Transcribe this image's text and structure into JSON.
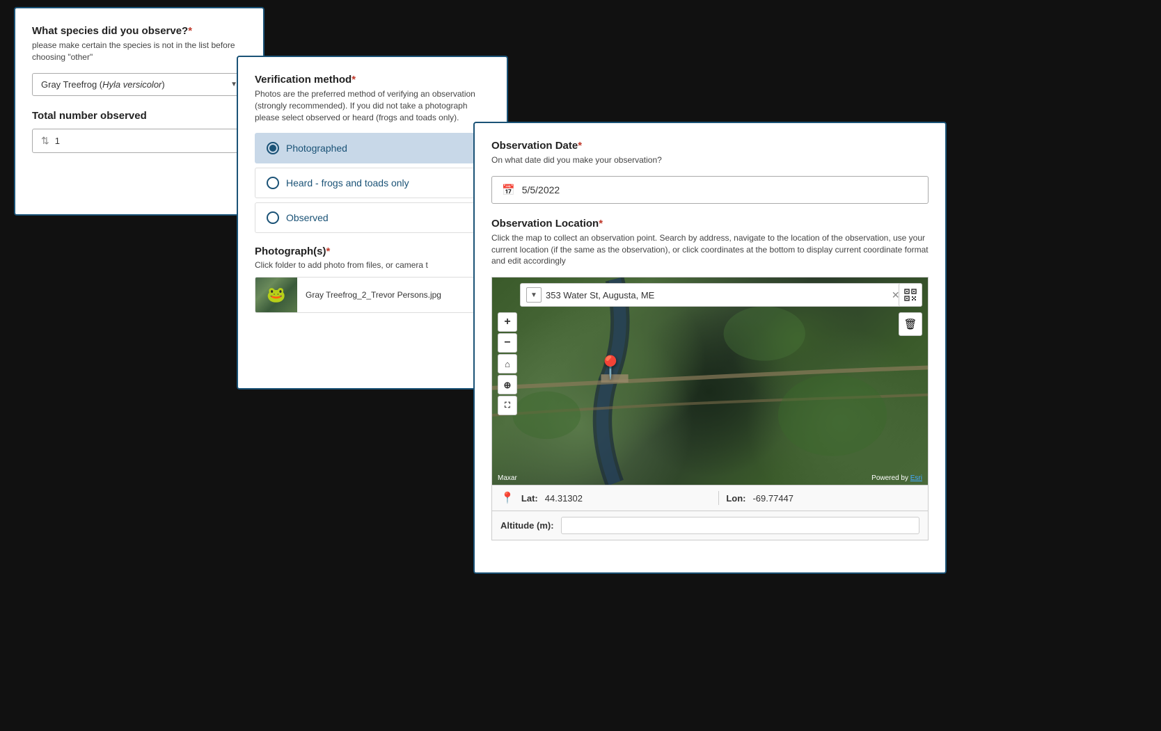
{
  "card1": {
    "title": "What species did you observe?",
    "required": "*",
    "desc": "please make certain the species is not in the list before choosing \"other\"",
    "dropdown_value": "Gray Treefrog (<i>Hyla versicolor</i>)",
    "dropdown_text": "Gray Treefrog (<i>Hyla versicolor</i>) ▼",
    "total_label": "Total number observed",
    "total_value": "1"
  },
  "card2": {
    "title": "Verification method",
    "required": "*",
    "desc": "Photos are the preferred method of verifying an observation (strongly recommended). If you did not take a photograph please select observed or heard (frogs and toads only).",
    "options": [
      {
        "id": "photo",
        "label": "Photographed",
        "selected": true
      },
      {
        "id": "heard",
        "label": "Heard - frogs and toads only",
        "selected": false
      },
      {
        "id": "observed",
        "label": "Observed",
        "selected": false
      }
    ],
    "photos_title": "Photograph(s)",
    "photos_required": "*",
    "photos_desc": "Click folder to add photo from files, or camera t",
    "photo_filename": "Gray Treefrog_2_Trevor Persons.jpg"
  },
  "card3": {
    "obs_date_title": "Observation Date",
    "obs_date_required": "*",
    "obs_date_desc": "On what date did you make your observation?",
    "obs_date_value": "5/5/2022",
    "obs_loc_title": "Observation Location",
    "obs_loc_required": "*",
    "obs_loc_desc": "Click the map to collect an observation point. Search by address, navigate to the location of the observation, use your current location (if the same as the observation), or click coordinates at the bottom to display current coordinate format and edit accordingly",
    "map_search": "353 Water St, Augusta, ME",
    "lat_label": "Lat:",
    "lat_value": "44.31302",
    "lon_label": "Lon:",
    "lon_value": "-69.77447",
    "altitude_label": "Altitude (m):",
    "altitude_value": "",
    "map_attribution_left": "Maxar",
    "map_attribution_right": "Powered by Esri"
  },
  "icons": {
    "dropdown_arrow": "▼",
    "sort": "⇅",
    "calendar": "📅",
    "search": "🔍",
    "close": "✕",
    "qr": "⊞",
    "trash": "🗑",
    "plus": "+",
    "minus": "−",
    "home": "⌂",
    "locate": "⊕",
    "expand": "⛶",
    "pin": "📍"
  }
}
